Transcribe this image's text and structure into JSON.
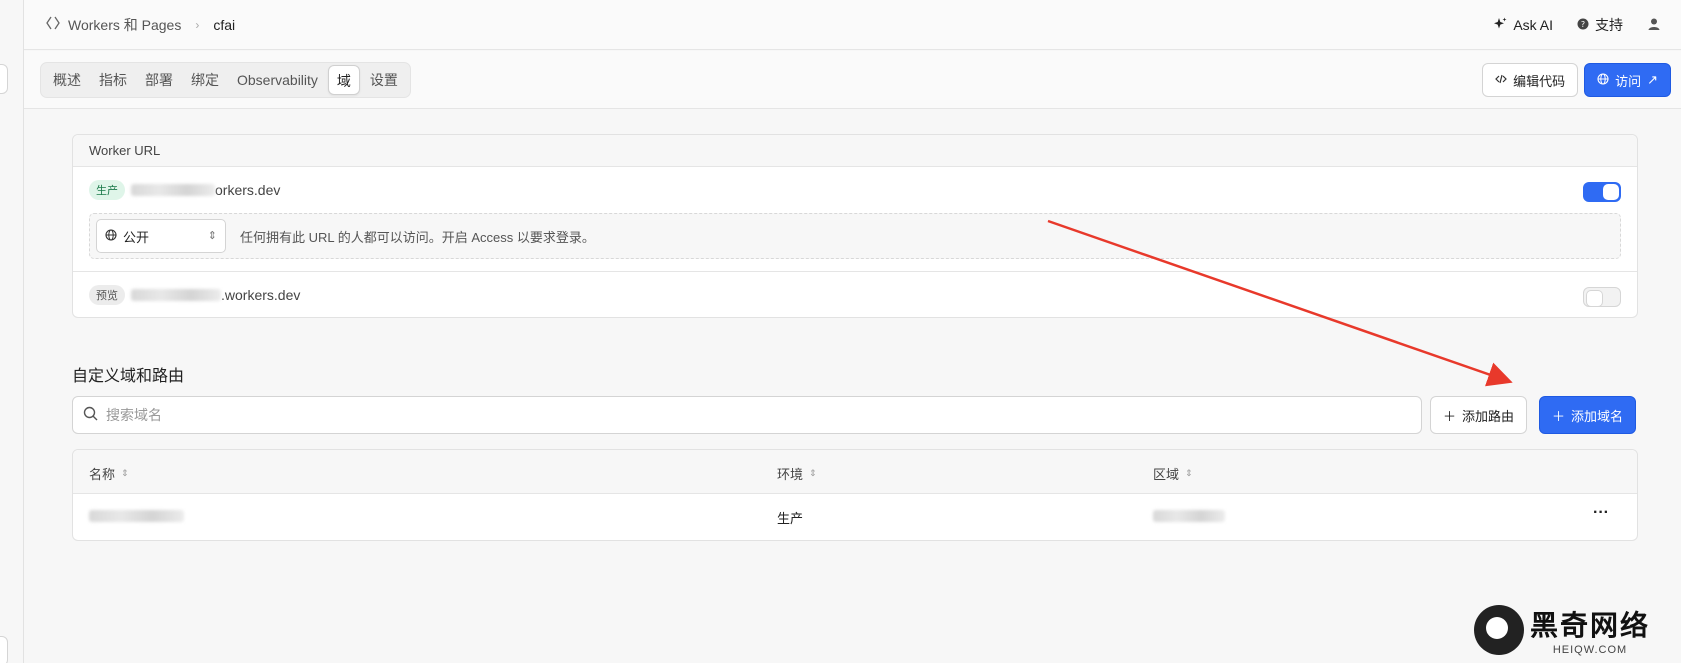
{
  "breadcrumb": {
    "parent": "Workers 和 Pages",
    "current": "cfai"
  },
  "topnav": {
    "ask_ai": "Ask AI",
    "support": "支持"
  },
  "tabs": [
    "概述",
    "指标",
    "部署",
    "绑定",
    "Observability",
    "域",
    "设置"
  ],
  "active_tab": "域",
  "actions": {
    "edit_code": "编辑代码",
    "visit": "访问"
  },
  "worker_url": {
    "header": "Worker URL",
    "production": {
      "badge": "生产",
      "url_suffix": "orkers.dev",
      "enabled": true
    },
    "access": {
      "select_value": "公开",
      "description": "任何拥有此 URL 的人都可以访问。开启 Access 以要求登录。"
    },
    "preview": {
      "badge": "预览",
      "url_suffix": ".workers.dev",
      "enabled": false
    }
  },
  "custom_domains": {
    "title": "自定义域和路由",
    "search_placeholder": "搜索域名",
    "add_route": "添加路由",
    "add_domain": "添加域名",
    "columns": [
      "名称",
      "环境",
      "区域"
    ],
    "rows": [
      {
        "environment": "生产",
        "menu": "···"
      }
    ]
  },
  "watermark": {
    "cn": "黑奇网络",
    "en": "HEIQW.COM"
  },
  "colors": {
    "primary": "#2f6bf3",
    "arrow": "#e8392b",
    "badge_green_bg": "#dff5e9"
  }
}
